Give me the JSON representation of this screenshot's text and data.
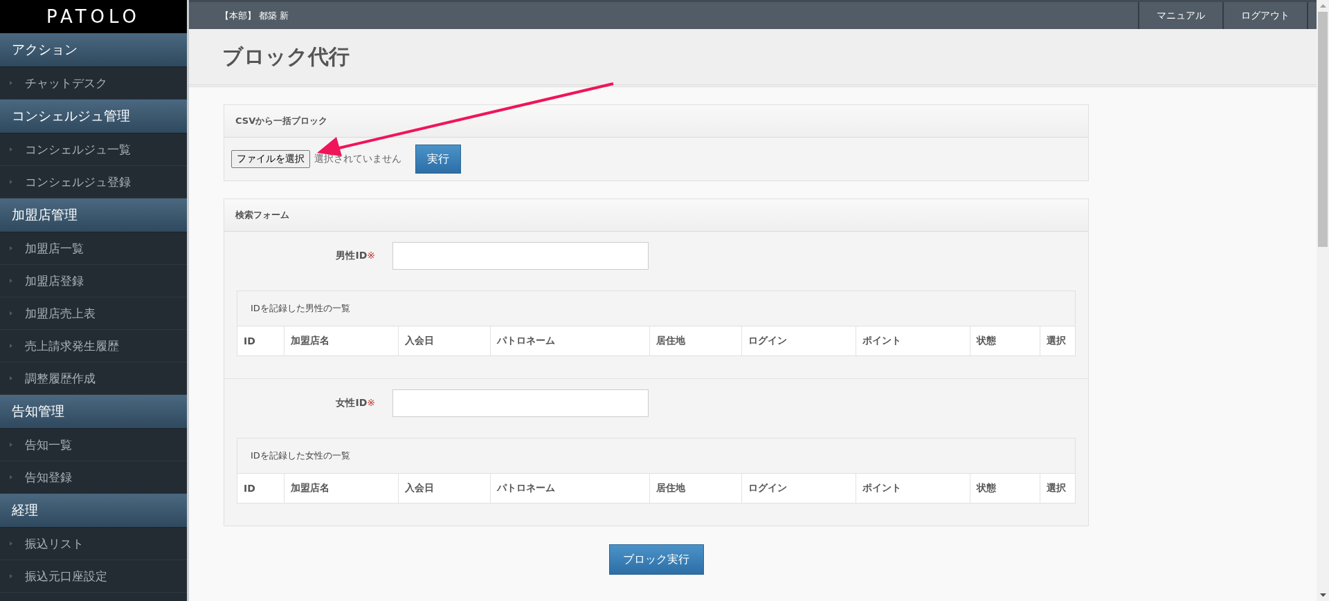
{
  "logo": "PATOLO",
  "sidebar": [
    {
      "heading": "アクション",
      "items": [
        {
          "label": "チャットデスク",
          "selected": false
        }
      ]
    },
    {
      "heading": "コンシェルジュ管理",
      "items": [
        {
          "label": "コンシェルジュ一覧",
          "selected": false
        },
        {
          "label": "コンシェルジュ登録",
          "selected": false
        }
      ]
    },
    {
      "heading": "加盟店管理",
      "items": [
        {
          "label": "加盟店一覧",
          "selected": false
        },
        {
          "label": "加盟店登録",
          "selected": false
        },
        {
          "label": "加盟店売上表",
          "selected": false
        },
        {
          "label": "売上請求発生履歴",
          "selected": false
        },
        {
          "label": "調整履歴作成",
          "selected": false
        }
      ]
    },
    {
      "heading": "告知管理",
      "items": [
        {
          "label": "告知一覧",
          "selected": false
        },
        {
          "label": "告知登録",
          "selected": false
        }
      ]
    },
    {
      "heading": "経理",
      "items": [
        {
          "label": "振込リスト",
          "selected": false
        },
        {
          "label": "振込元口座設定",
          "selected": false
        }
      ]
    }
  ],
  "header": {
    "user": "【本部】 都築 新",
    "links": [
      "マニュアル",
      "ログアウト"
    ]
  },
  "page_title": "ブロック代行",
  "csv_panel": {
    "title": "CSVから一括ブロック",
    "file_button": "ファイルを選択",
    "file_status": "選択されていません",
    "submit": "実行"
  },
  "search_form": {
    "title": "検索フォーム",
    "sections": [
      {
        "label": "男性ID",
        "required_mark": "※",
        "list_title": "IDを記録した男性の一覧",
        "columns": [
          "ID",
          "加盟店名",
          "入会日",
          "パトロネーム",
          "居住地",
          "ログイン",
          "ポイント",
          "状態",
          "選択"
        ]
      },
      {
        "label": "女性ID",
        "required_mark": "※",
        "list_title": "IDを記録した女性の一覧",
        "columns": [
          "ID",
          "加盟店名",
          "入会日",
          "パトロネーム",
          "居住地",
          "ログイン",
          "ポイント",
          "状態",
          "選択"
        ]
      }
    ]
  },
  "submit": "ブロック実行"
}
